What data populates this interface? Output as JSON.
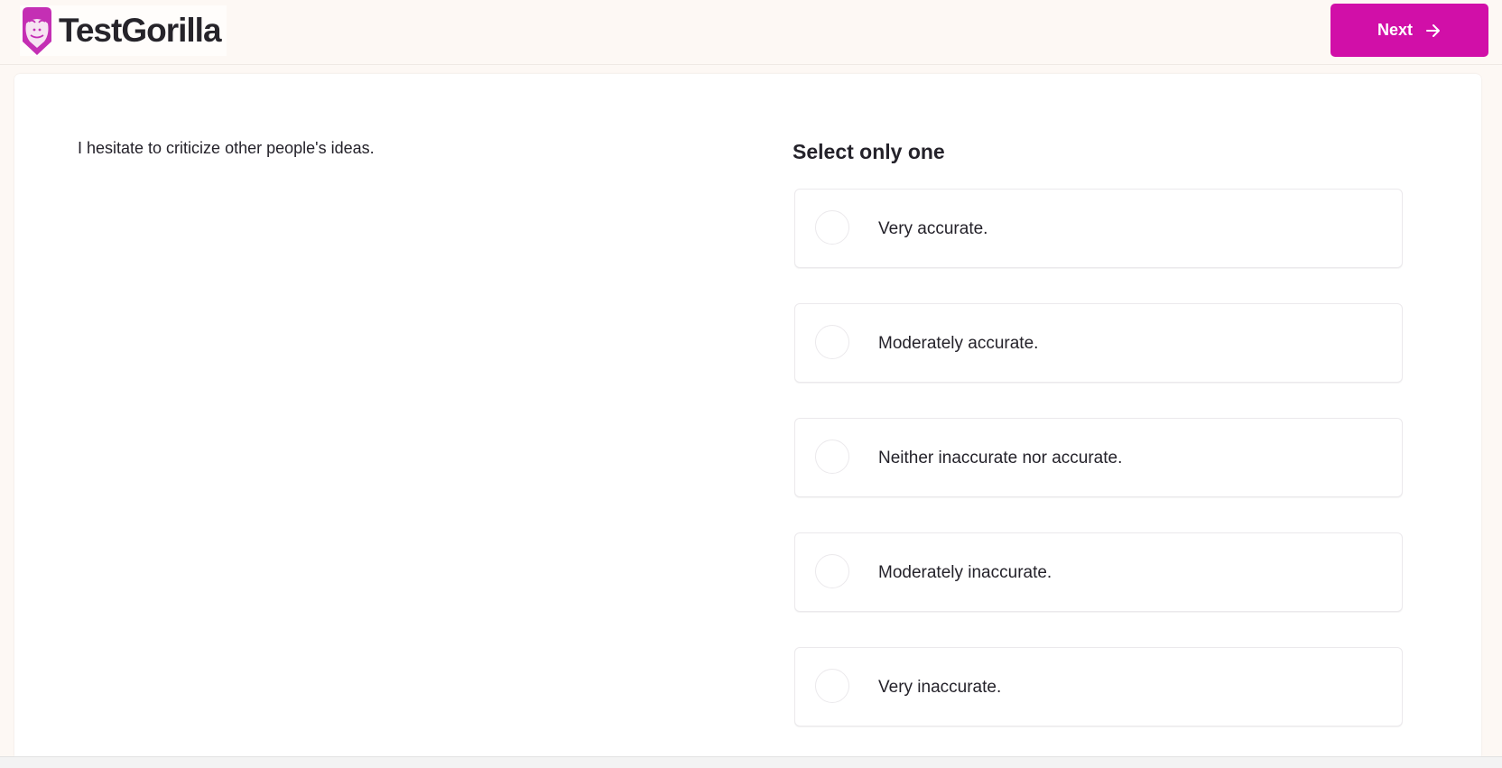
{
  "header": {
    "brand": "TestGorilla",
    "logo_icon": "gorilla-logo-icon",
    "next_label": "Next",
    "next_icon": "arrow-right-icon",
    "accent_color": "#d10fa8"
  },
  "question": {
    "text": "I hesitate to criticize other people's ideas."
  },
  "answers": {
    "instruction": "Select only one",
    "options": [
      {
        "label": "Very accurate.",
        "selected": false
      },
      {
        "label": "Moderately accurate.",
        "selected": false
      },
      {
        "label": "Neither inaccurate nor accurate.",
        "selected": false
      },
      {
        "label": "Moderately inaccurate.",
        "selected": false
      },
      {
        "label": "Very inaccurate.",
        "selected": false
      }
    ]
  }
}
